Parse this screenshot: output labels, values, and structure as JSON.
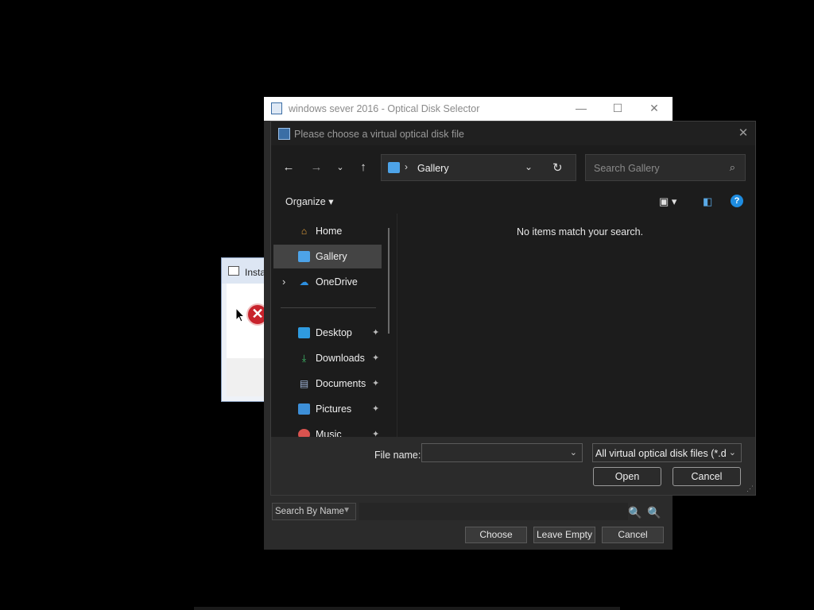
{
  "installer": {
    "title": "Insta"
  },
  "selector": {
    "title": "windows sever 2016 - Optical Disk Selector",
    "window_controls": {
      "minimize": "—",
      "maximize": "☐",
      "close": "✕"
    },
    "search_mode": "Search By Name",
    "buttons": {
      "choose": "Choose",
      "leave_empty": "Leave Empty",
      "cancel": "Cancel"
    }
  },
  "dialog": {
    "title": "Please choose a virtual optical disk file",
    "address": "Gallery",
    "search_placeholder": "Search Gallery",
    "organize_label": "Organize ▾",
    "empty_message": "No items match your search.",
    "nav": {
      "home": "Home",
      "gallery": "Gallery",
      "onedrive": "OneDrive",
      "desktop": "Desktop",
      "downloads": "Downloads",
      "documents": "Documents",
      "pictures": "Pictures",
      "music": "Music"
    },
    "file_name_label": "File name:",
    "file_name_value": "",
    "file_type": "All virtual optical disk files (*.dr",
    "buttons": {
      "open": "Open",
      "cancel": "Cancel"
    }
  },
  "icons": [
    "back-arrow-icon",
    "forward-arrow-icon",
    "recent-chevron-icon",
    "up-arrow-icon",
    "gallery-icon",
    "refresh-icon",
    "search-icon",
    "view-icon",
    "preview-pane-icon",
    "help-icon",
    "home-icon",
    "onedrive-icon",
    "desktop-icon",
    "downloads-icon",
    "documents-icon",
    "pictures-icon",
    "music-icon",
    "pin-icon",
    "error-icon"
  ]
}
